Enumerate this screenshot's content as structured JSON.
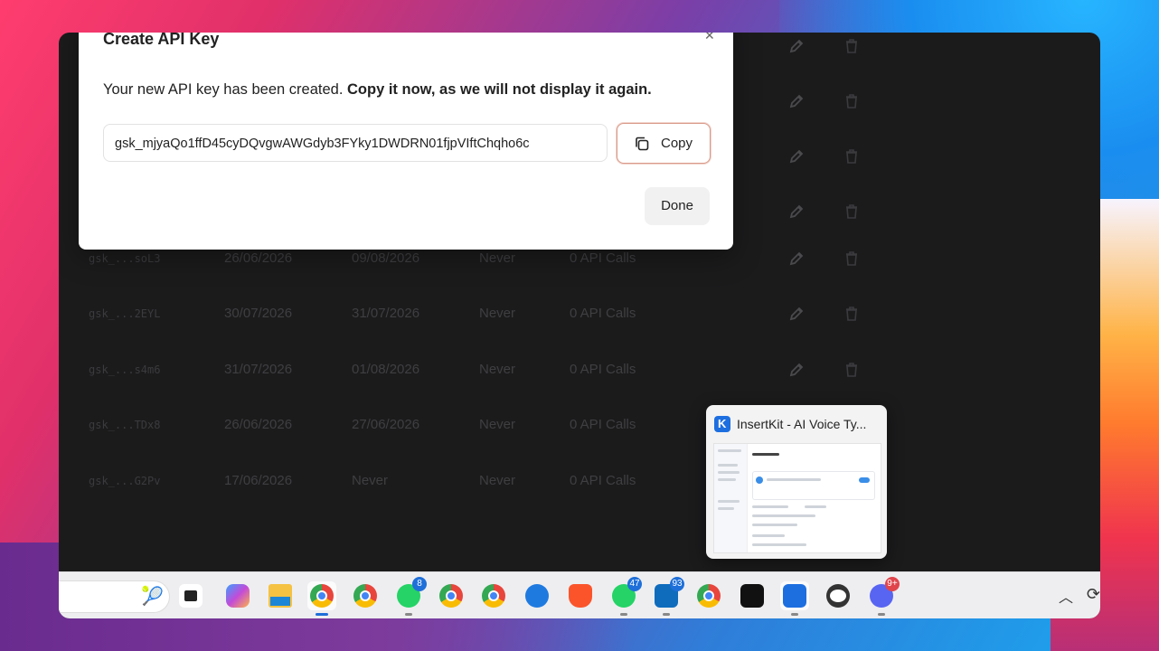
{
  "modal": {
    "title": "Create API Key",
    "message_plain": "Your new API key has been created. ",
    "message_bold": "Copy it now, as we will not display it again.",
    "api_key_value": "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",
    "copy_label": "Copy",
    "done_label": "Done"
  },
  "table": {
    "rows": [
      {
        "key": "gsk_...soL3",
        "created": "26/06/2026",
        "last_used": "09/08/2026",
        "expires": "Never",
        "usage": "0 API Calls"
      },
      {
        "key": "gsk_...2EYL",
        "created": "30/07/2026",
        "last_used": "31/07/2026",
        "expires": "Never",
        "usage": "0 API Calls"
      },
      {
        "key": "gsk_...s4m6",
        "created": "31/07/2026",
        "last_used": "01/08/2026",
        "expires": "Never",
        "usage": "0 API Calls"
      },
      {
        "key": "gsk_...TDx8",
        "created": "26/06/2026",
        "last_used": "27/06/2026",
        "expires": "Never",
        "usage": "0 API Calls"
      },
      {
        "key": "gsk_...G2Pv",
        "created": "17/06/2026",
        "last_used": "Never",
        "expires": "Never",
        "usage": "0 API Calls"
      }
    ]
  },
  "taskbar_preview": {
    "title": "InsertKit - AI Voice Ty..."
  },
  "taskbar": {
    "search_emoji": "🎾",
    "badges": {
      "whatsapp": "8",
      "whatsapp2": "47",
      "outlook": "93",
      "discord": "9+"
    }
  },
  "colors": {
    "accent_copy_border": "#d99a8a",
    "backdrop": "#1b1b1c",
    "badge_blue": "#1e6fd9",
    "badge_red": "#e0454c"
  }
}
